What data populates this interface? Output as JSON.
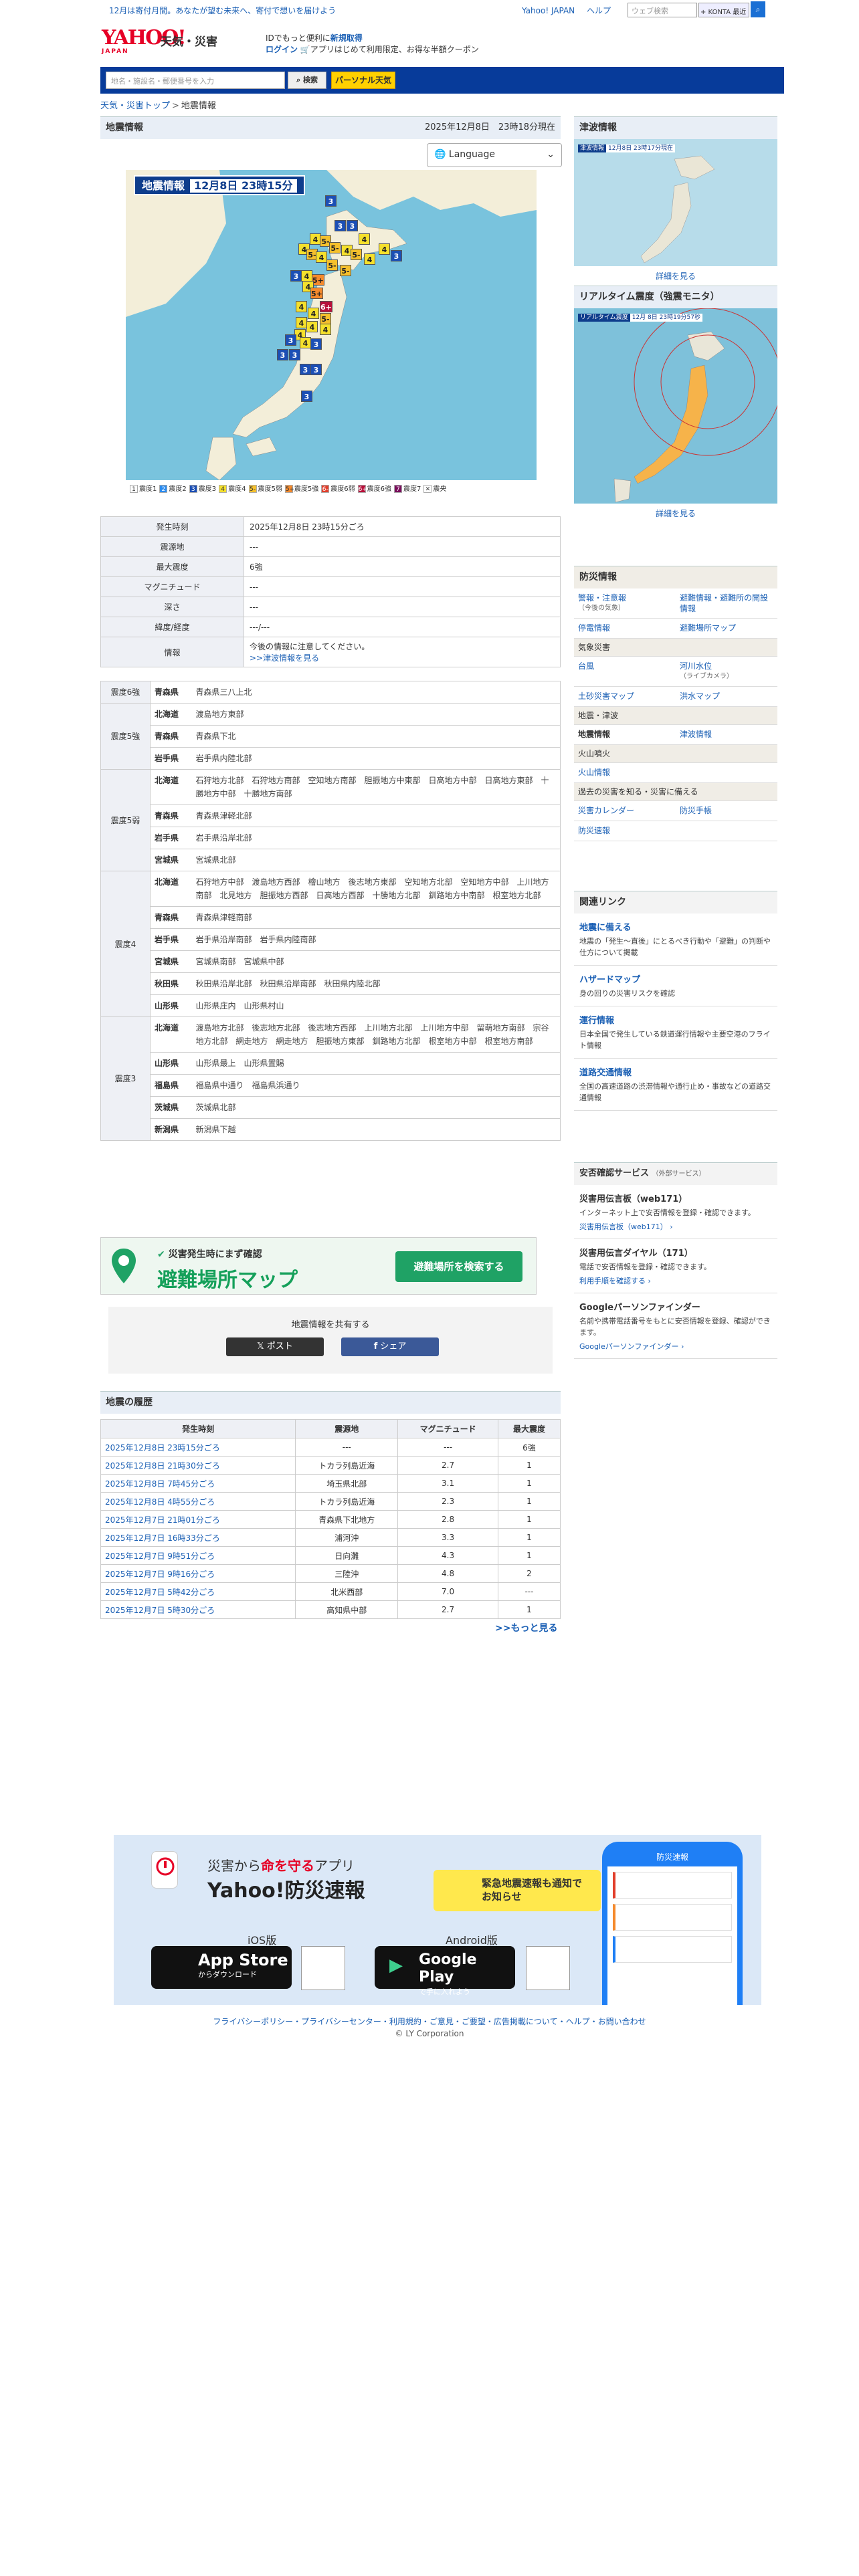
{
  "topbar": {
    "message": "12月は寄付月間。あなたが望む未来へ、寄付で想いを届けよう",
    "links": [
      "Yahoo! JAPAN",
      "ヘルプ"
    ],
    "search_placeholder": "ウェブ検索",
    "search_toggle": "+ KONTA 最近"
  },
  "header": {
    "logo_text": "YAHOO!",
    "logo_sub": "JAPAN",
    "site_title": "天気・災害",
    "login_line1_pre": "IDでもっと便利に",
    "login_line1_link": "新規取得",
    "login_line2_link": "ログイン",
    "login_line2_post": "アプリはじめて利用限定、お得な半額クーポン"
  },
  "nav": {
    "search_placeholder": "地名・施設名・郵便番号を入力",
    "search_button": "検索",
    "personal_button": "パーソナル天気"
  },
  "breadcrumb": [
    "天気・災害トップ",
    "地震情報"
  ],
  "main": {
    "title": "地震情報",
    "datetime": "2025年12月8日　23時18分現在",
    "language_label": "Language",
    "map_title": "地震情報",
    "map_date": "12月8日 23時15分",
    "legend": [
      {
        "label": "震度1",
        "mark": "1",
        "color": "#ffffff"
      },
      {
        "label": "震度2",
        "mark": "2",
        "color": "#2c8cf0"
      },
      {
        "label": "震度3",
        "mark": "3",
        "color": "#1c4fb5"
      },
      {
        "label": "震度4",
        "mark": "4",
        "color": "#f5e02c"
      },
      {
        "label": "震度5弱",
        "mark": "5-",
        "color": "#f5c02c"
      },
      {
        "label": "震度5強",
        "mark": "5+",
        "color": "#f58a2c"
      },
      {
        "label": "震度6弱",
        "mark": "6-",
        "color": "#e23f2c"
      },
      {
        "label": "震度6強",
        "mark": "6+",
        "color": "#b8103b"
      },
      {
        "label": "震度7",
        "mark": "7",
        "color": "#7a0d5c"
      },
      {
        "label": "震央",
        "mark": "✕",
        "color": "#ffffff"
      }
    ]
  },
  "info": [
    {
      "label": "発生時刻",
      "value": "2025年12月8日 23時15分ごろ"
    },
    {
      "label": "震源地",
      "value": "---"
    },
    {
      "label": "最大震度",
      "value": "6強"
    },
    {
      "label": "マグニチュード",
      "value": "---"
    },
    {
      "label": "深さ",
      "value": "---"
    },
    {
      "label": "緯度/経度",
      "value": "---/---"
    },
    {
      "label": "情報",
      "value": "今後の情報に注意してください。",
      "link": ">>津波情報を見る"
    }
  ],
  "shindo": [
    {
      "level": "震度6強",
      "rows": [
        {
          "pref": "青森県",
          "areas": "青森県三八上北"
        }
      ]
    },
    {
      "level": "震度5強",
      "rows": [
        {
          "pref": "北海道",
          "areas": "渡島地方東部"
        },
        {
          "pref": "青森県",
          "areas": "青森県下北"
        },
        {
          "pref": "岩手県",
          "areas": "岩手県内陸北部"
        }
      ]
    },
    {
      "level": "震度5弱",
      "rows": [
        {
          "pref": "北海道",
          "areas": "石狩地方北部　石狩地方南部　空知地方南部　胆振地方中東部　日高地方中部　日高地方東部　十勝地方中部　十勝地方南部"
        },
        {
          "pref": "青森県",
          "areas": "青森県津軽北部"
        },
        {
          "pref": "岩手県",
          "areas": "岩手県沿岸北部"
        },
        {
          "pref": "宮城県",
          "areas": "宮城県北部"
        }
      ]
    },
    {
      "level": "震度4",
      "rows": [
        {
          "pref": "北海道",
          "areas": "石狩地方中部　渡島地方西部　檜山地方　後志地方東部　空知地方北部　空知地方中部　上川地方南部　北見地方　胆振地方西部　日高地方西部　十勝地方北部　釧路地方中南部　根室地方北部"
        },
        {
          "pref": "青森県",
          "areas": "青森県津軽南部"
        },
        {
          "pref": "岩手県",
          "areas": "岩手県沿岸南部　岩手県内陸南部"
        },
        {
          "pref": "宮城県",
          "areas": "宮城県南部　宮城県中部"
        },
        {
          "pref": "秋田県",
          "areas": "秋田県沿岸北部　秋田県沿岸南部　秋田県内陸北部"
        },
        {
          "pref": "山形県",
          "areas": "山形県庄内　山形県村山"
        }
      ]
    },
    {
      "level": "震度3",
      "rows": [
        {
          "pref": "北海道",
          "areas": "渡島地方北部　後志地方北部　後志地方西部　上川地方北部　上川地方中部　留萌地方南部　宗谷地方北部　網走地方　網走地方　胆振地方東部　釧路地方北部　根室地方中部　根室地方南部"
        },
        {
          "pref": "山形県",
          "areas": "山形県最上　山形県置賜"
        },
        {
          "pref": "福島県",
          "areas": "福島県中通り　福島県浜通り"
        },
        {
          "pref": "茨城県",
          "areas": "茨城県北部"
        },
        {
          "pref": "新潟県",
          "areas": "新潟県下越"
        }
      ]
    }
  ],
  "evacuation": {
    "sub": "災害発生時にまず確認",
    "title": "避難場所マップ",
    "button": "避難場所を検索する"
  },
  "share": {
    "label": "地震情報を共有する",
    "x_button": "ポスト",
    "fb_button": "シェア"
  },
  "history": {
    "title": "地震の履歴",
    "headers": [
      "発生時刻",
      "震源地",
      "マグニチュード",
      "最大震度"
    ],
    "rows": [
      [
        "2025年12月8日 23時15分ごろ",
        "---",
        "---",
        "6強"
      ],
      [
        "2025年12月8日 21時30分ごろ",
        "トカラ列島近海",
        "2.7",
        "1"
      ],
      [
        "2025年12月8日 7時45分ごろ",
        "埼玉県北部",
        "3.1",
        "1"
      ],
      [
        "2025年12月8日 4時55分ごろ",
        "トカラ列島近海",
        "2.3",
        "1"
      ],
      [
        "2025年12月7日 21時01分ごろ",
        "青森県下北地方",
        "2.8",
        "1"
      ],
      [
        "2025年12月7日 16時33分ごろ",
        "浦河沖",
        "3.3",
        "1"
      ],
      [
        "2025年12月7日 9時51分ごろ",
        "日向灘",
        "4.3",
        "1"
      ],
      [
        "2025年12月7日 9時16分ごろ",
        "三陸沖",
        "4.8",
        "2"
      ],
      [
        "2025年12月7日 5時42分ごろ",
        "北米西部",
        "7.0",
        "---"
      ],
      [
        "2025年12月7日 5時30分ごろ",
        "高知県中部",
        "2.7",
        "1"
      ]
    ],
    "more": ">>もっと見る"
  },
  "right": {
    "tsunami_title": "津波情報",
    "tsunami_map_label": "津波情報",
    "tsunami_map_date": "12月8日 23時17分現在",
    "tsunami_link": "詳細を見る",
    "realtime_title": "リアルタイム震度（強震モニタ）",
    "realtime_map_label": "リアルタイム震度",
    "realtime_map_date": "12月 8日 23時19分57秒",
    "realtime_link": "詳細を見る",
    "bousai_title": "防災情報",
    "bousai_rows": [
      {
        "type": "pair",
        "a": "警報・注意報",
        "a_sub": "（今後の気象）",
        "b": "避難情報・避難所の開設情報"
      },
      {
        "type": "pair",
        "a": "停電情報",
        "b": "避難場所マップ"
      },
      {
        "type": "cat",
        "a": "気象災害"
      },
      {
        "type": "pair",
        "a": "台風",
        "b": "河川水位",
        "b_sub": "（ライブカメラ）"
      },
      {
        "type": "pair",
        "a": "土砂災害マップ",
        "b": "洪水マップ"
      },
      {
        "type": "cat",
        "a": "地震・津波"
      },
      {
        "type": "pair",
        "a": "地震情報",
        "b": "津波情報",
        "current": "a"
      },
      {
        "type": "cat",
        "a": "火山噴火"
      },
      {
        "type": "pair",
        "a": "火山情報",
        "b": ""
      },
      {
        "type": "cat",
        "a": "過去の災害を知る・災害に備える"
      },
      {
        "type": "pair",
        "a": "災害カレンダー",
        "b": "防災手帳"
      },
      {
        "type": "pair",
        "a": "防災速報",
        "b": ""
      }
    ],
    "kanren_title": "関連リンク",
    "kanren": [
      {
        "title": "地震に備える",
        "desc": "地震の「発生〜直後」にとるべき行動や「避難」の判断や仕方について掲載"
      },
      {
        "title": "ハザードマップ",
        "desc": "身の回りの災害リスクを確認"
      },
      {
        "title": "運行情報",
        "desc": "日本全国で発生している鉄道運行情報や主要空港のフライト情報"
      },
      {
        "title": "道路交通情報",
        "desc": "全国の高速道路の渋滞情報や通行止め・事故などの道路交通情報"
      }
    ],
    "anpi_title": "安否確認サービス",
    "anpi_sub": "（外部サービス）",
    "anpi": [
      {
        "title": "災害用伝言板（web171）",
        "desc": "インターネット上で安否情報を登録・確認できます。",
        "link": "災害用伝言板（web171）"
      },
      {
        "title": "災害用伝言ダイヤル（171）",
        "desc": "電話で安否情報を登録・確認できます。",
        "link": "利用手順を確認する"
      },
      {
        "title": "Googleパーソンファインダー",
        "desc": "名前や携帯電話番号をもとに安否情報を登録、確認ができます。",
        "link": "Googleパーソンファインダー"
      }
    ]
  },
  "banner": {
    "sub_pre": "災害から",
    "sub_em": "命を守る",
    "sub_post": "アプリ",
    "title": "Yahoo!防災速報",
    "alert": "緊急地震速報も通知でお知らせ",
    "ios_label": "iOS版",
    "android_label": "Android版",
    "appstore_big": "App Store",
    "appstore_small": "からダウンロード",
    "gplay_big": "Google Play",
    "gplay_small": "で手に入れよう",
    "phone_header": "防災速報"
  },
  "footer": {
    "links": "フライバシーポリシー・プライバシーセンター・利用規約・ご意見・ご要望・広告掲載について・ヘルプ・お問い合わせ",
    "copyright": "© LY Corporation"
  }
}
